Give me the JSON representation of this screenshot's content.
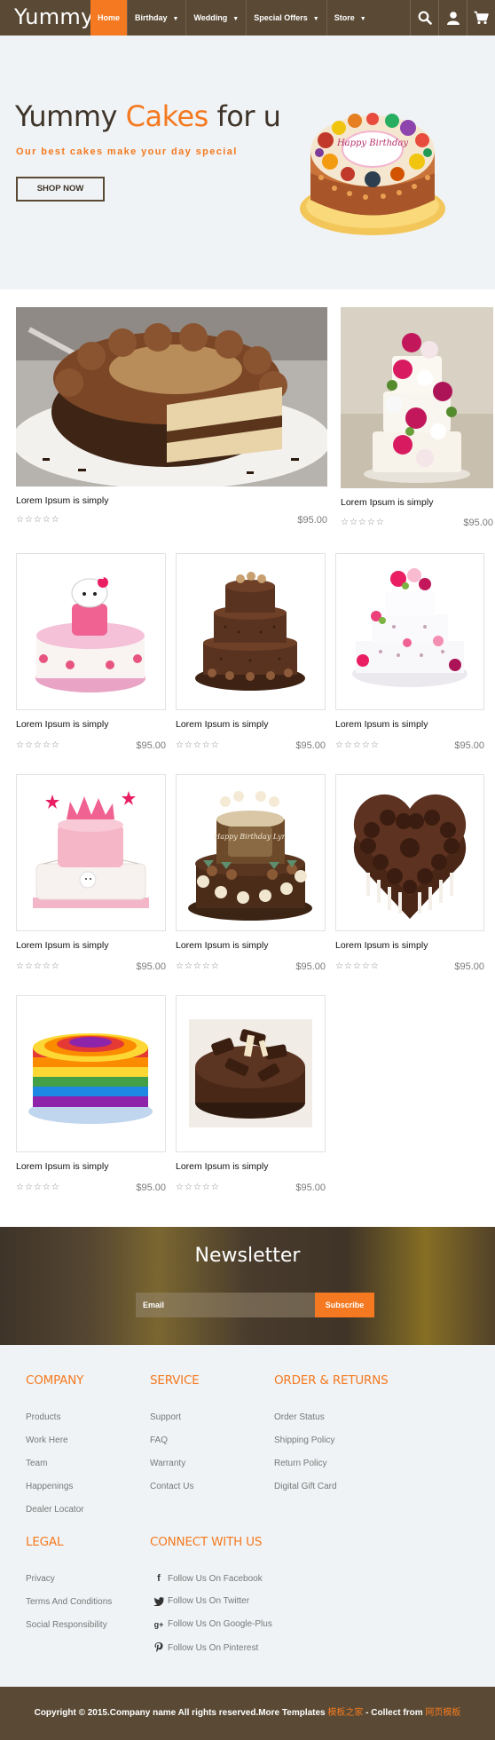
{
  "brand": {
    "logo": "Yummy"
  },
  "nav": {
    "items": [
      {
        "label": "Home",
        "active": true,
        "dropdown": false
      },
      {
        "label": "Birthday",
        "active": false,
        "dropdown": true
      },
      {
        "label": "Wedding",
        "active": false,
        "dropdown": true
      },
      {
        "label": "Special Offers",
        "active": false,
        "dropdown": true
      },
      {
        "label": "Store",
        "active": false,
        "dropdown": true
      }
    ],
    "icons": [
      "search-icon",
      "user-icon",
      "cart-icon"
    ]
  },
  "hero": {
    "title_part1": "Yummy ",
    "title_accent": "Cakes",
    "title_part2": " for u",
    "subtitle": "Our best cakes make your day special",
    "button": "SHOP NOW",
    "cake_topper": "Happy Birthday"
  },
  "products": [
    {
      "name": "Lorem Ipsum is simply",
      "price": "$95.00",
      "rating": "☆☆☆☆☆",
      "image": "chocolate-cream-cake"
    },
    {
      "name": "Lorem Ipsum is simply",
      "price": "$95.00",
      "rating": "☆☆☆☆☆",
      "image": "white-rose-wedding-cake"
    },
    {
      "name": "Lorem Ipsum is simply",
      "price": "$95.00",
      "rating": "☆☆☆☆☆",
      "image": "hello-kitty-cake"
    },
    {
      "name": "Lorem Ipsum is simply",
      "price": "$95.00",
      "rating": "☆☆☆☆☆",
      "image": "three-tier-chocolate-cake"
    },
    {
      "name": "Lorem Ipsum is simply",
      "price": "$95.00",
      "rating": "☆☆☆☆☆",
      "image": "floral-wedding-cake"
    },
    {
      "name": "Lorem Ipsum is simply",
      "price": "$95.00",
      "rating": "☆☆☆☆☆",
      "image": "pink-crown-cake"
    },
    {
      "name": "Lorem Ipsum is simply",
      "price": "$95.00",
      "rating": "☆☆☆☆☆",
      "image": "chocolate-birthday-tier-cake",
      "topper": "Happy Birthday Lyn"
    },
    {
      "name": "Lorem Ipsum is simply",
      "price": "$95.00",
      "rating": "☆☆☆☆☆",
      "image": "chocolate-heart-cake"
    },
    {
      "name": "Lorem Ipsum is simply",
      "price": "$95.00",
      "rating": "☆☆☆☆☆",
      "image": "rainbow-layer-cake"
    },
    {
      "name": "Lorem Ipsum is simply",
      "price": "$95.00",
      "rating": "☆☆☆☆☆",
      "image": "chocolate-curl-cake"
    }
  ],
  "newsletter": {
    "title": "Newsletter",
    "placeholder": "Email",
    "button": "Subscribe"
  },
  "footer": {
    "company": {
      "heading": "COMPANY",
      "links": [
        "Products",
        "Work Here",
        "Team",
        "Happenings",
        "Dealer Locator"
      ]
    },
    "service": {
      "heading": "SERVICE",
      "links": [
        "Support",
        "FAQ",
        "Warranty",
        "Contact Us"
      ]
    },
    "orders": {
      "heading": "ORDER & RETURNS",
      "links": [
        "Order Status",
        "Shipping Policy",
        "Return Policy",
        "Digital Gift Card"
      ]
    },
    "legal": {
      "heading": "LEGAL",
      "links": [
        "Privacy",
        "Terms And Conditions",
        "Social Responsibility"
      ]
    },
    "connect": {
      "heading": "CONNECT WITH US",
      "links": [
        {
          "label": "Follow Us On Facebook",
          "icon": "facebook-icon"
        },
        {
          "label": "Follow Us On Twitter",
          "icon": "twitter-icon"
        },
        {
          "label": "Follow Us On Google-Plus",
          "icon": "google-plus-icon"
        },
        {
          "label": "Follow Us On Pinterest",
          "icon": "pinterest-icon"
        }
      ]
    }
  },
  "copyright": {
    "text": "Copyright © 2015.Company name All rights reserved.More Templates ",
    "link1": "模板之家",
    "mid": " - Collect from ",
    "link2": "网页模板"
  },
  "colors": {
    "brown": "#5a4a35",
    "orange": "#f47920",
    "hero_bg": "#f0f3f5"
  }
}
